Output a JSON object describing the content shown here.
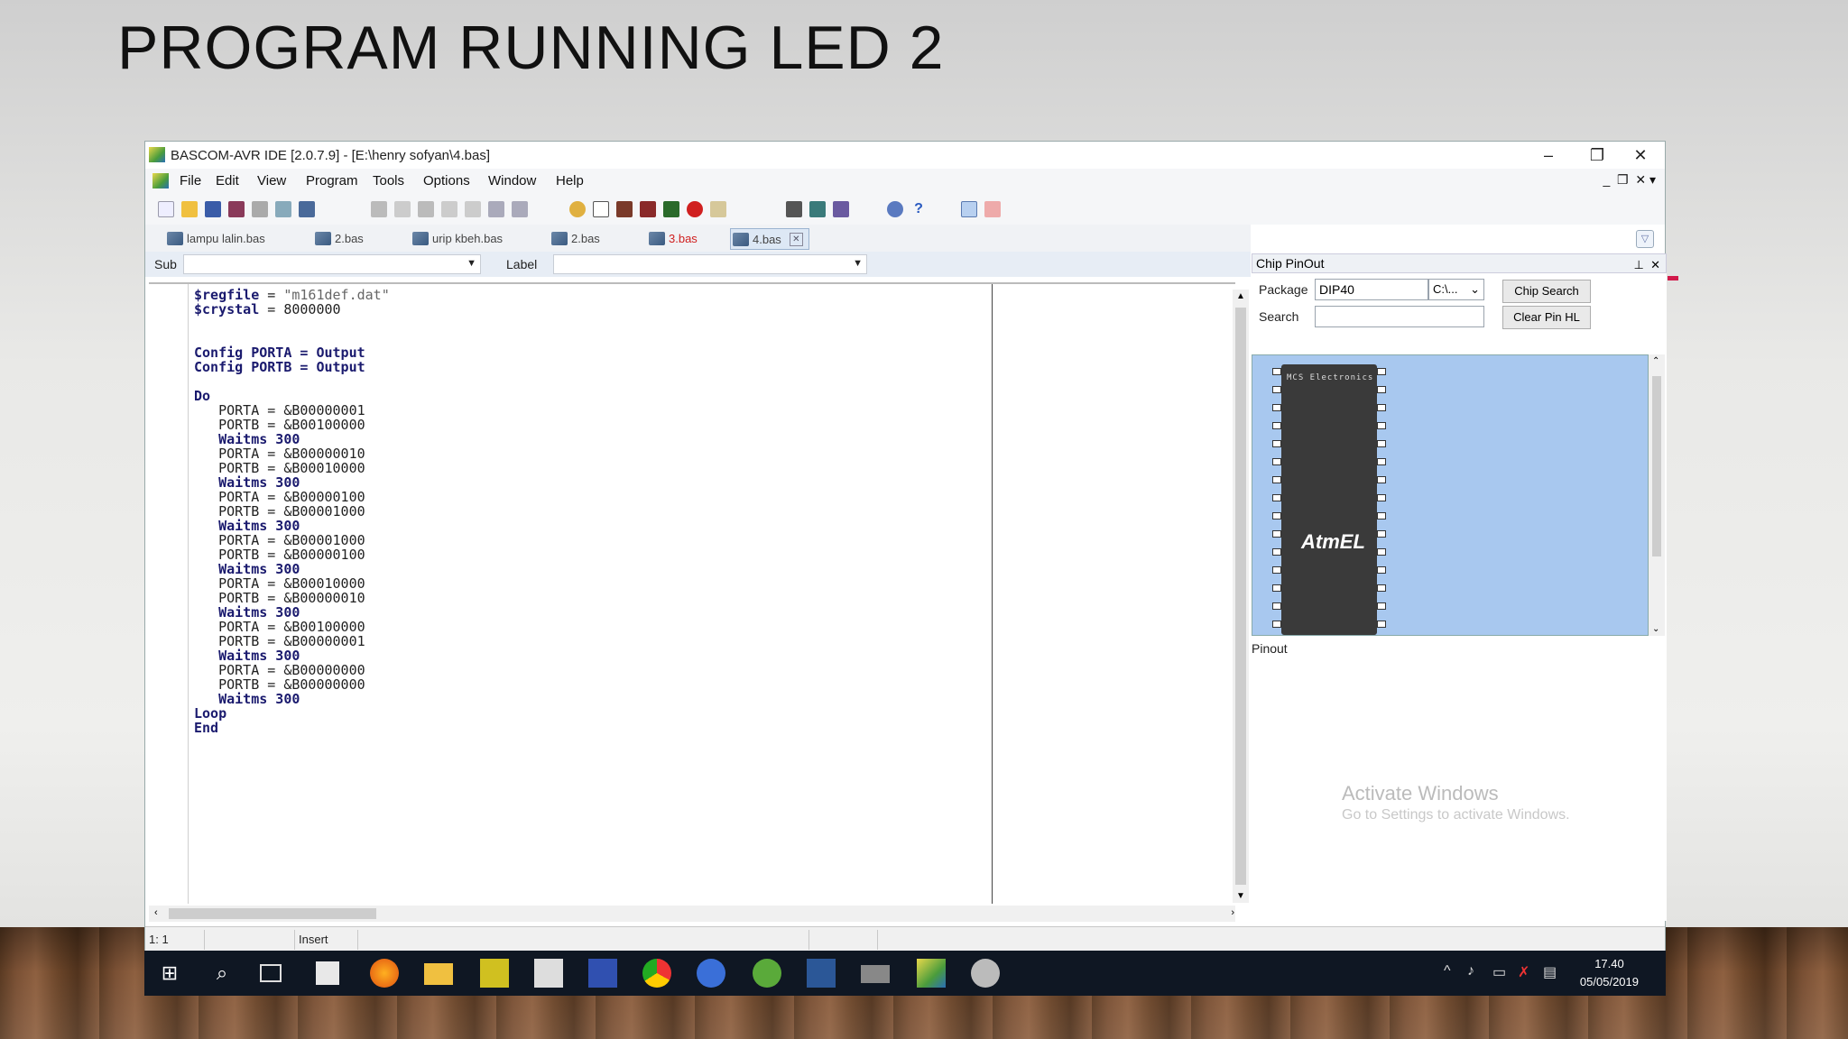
{
  "slide": {
    "title": "PROGRAM RUNNING LED 2"
  },
  "window": {
    "title": "BASCOM-AVR IDE [2.0.7.9] - [E:\\henry sofyan\\4.bas]"
  },
  "menu": [
    "File",
    "Edit",
    "View",
    "Program",
    "Tools",
    "Options",
    "Window",
    "Help"
  ],
  "tabs": [
    {
      "label": "lampu lalin.bas"
    },
    {
      "label": "2.bas"
    },
    {
      "label": "urip kbeh.bas"
    },
    {
      "label": "2.bas"
    },
    {
      "label": "3.bas"
    },
    {
      "label": "4.bas"
    }
  ],
  "subbar": {
    "sub_label": "Sub",
    "label_label": "Label"
  },
  "code": {
    "l1a": "$regfile",
    "l1b": " = ",
    "l1c": "\"m161def.dat\"",
    "l2a": "$crystal",
    "l2b": " = 8000000",
    "l3": "Config PORTA = Output",
    "l4": "Config PORTB = Output",
    "do": "Do",
    "lines": [
      "   PORTA = &B00000001",
      "   PORTB = &B00100000",
      "   Waitms 300",
      "   PORTA = &B00000010",
      "   PORTB = &B00010000",
      "   Waitms 300",
      "   PORTA = &B00000100",
      "   PORTB = &B00001000",
      "   Waitms 300",
      "   PORTA = &B00001000",
      "   PORTB = &B00000100",
      "   Waitms 300",
      "   PORTA = &B00010000",
      "   PORTB = &B00000010",
      "   Waitms 300",
      "   PORTA = &B00100000",
      "   PORTB = &B00000001",
      "   Waitms 300",
      "   PORTA = &B00000000",
      "   PORTB = &B00000000",
      "   Waitms 300"
    ],
    "loop": "Loop",
    "end": "End"
  },
  "status": {
    "pos": "1: 1",
    "mode": "Insert"
  },
  "chip_panel": {
    "title": "Chip PinOut",
    "package_label": "Package",
    "package_value": "DIP40",
    "path_value": "C:\\...",
    "search_label": "Search",
    "search_value": "",
    "chip_search_btn": "Chip Search",
    "clear_pin_btn": "Clear Pin HL",
    "chip_label": "MCS Electronics",
    "chip_logo": "AtmEL",
    "pinout_label": "Pinout"
  },
  "watermark": {
    "line1": "Activate Windows",
    "line2": "Go to Settings to activate Windows."
  },
  "clock": {
    "time": "17.40",
    "date": "05/05/2019"
  }
}
